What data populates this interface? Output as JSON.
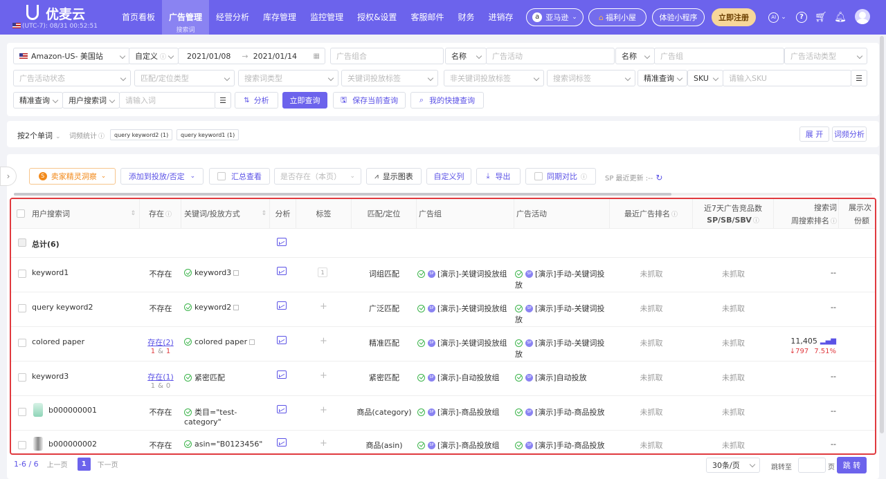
{
  "app": {
    "logo": "优麦云",
    "timezone": "(UTC-7): 08/31 00:52:51"
  },
  "nav": [
    {
      "label": "首页看板"
    },
    {
      "label": "广告管理",
      "sub": "搜索词",
      "active": true
    },
    {
      "label": "经营分析"
    },
    {
      "label": "库存管理"
    },
    {
      "label": "监控管理"
    },
    {
      "label": "授权&设置"
    },
    {
      "label": "客服邮件"
    },
    {
      "label": "财务"
    },
    {
      "label": "进销存"
    }
  ],
  "header": {
    "platform": "亚马逊",
    "welfare": "福利小屋",
    "miniapp": "体验小程序",
    "register": "立即注册",
    "ai": "AI"
  },
  "filters": {
    "store": "Amazon-US- 美国站",
    "date_mode": "自定义",
    "date_start": "2021/01/08",
    "date_end": "2021/01/14",
    "ad_group_ph": "广告组合",
    "name1": "名称",
    "campaign_ph": "广告活动",
    "name2": "名称",
    "adgroup_ph": "广告组",
    "campaign_type_ph": "广告活动类型",
    "campaign_status_ph": "广告活动状态",
    "match_type_ph": "匹配/定位类型",
    "search_type_ph": "搜索词类型",
    "kw_tag_ph": "关键词投放标签",
    "nonkw_tag_ph": "非关键词投放标签",
    "search_tag_ph": "搜索词标签",
    "exact1": "精准查询",
    "sku": "SKU",
    "sku_ph": "请输入SKU",
    "exact2": "精准查询",
    "user_search": "用户搜索词",
    "input_ph": "请输入词",
    "analyze": "分析",
    "query": "立即查询",
    "save": "保存当前查询",
    "quick": "我的快捷查询"
  },
  "words": {
    "split": "按2个单词",
    "freq": "词频统计",
    "tags": [
      "query keyword2 (1)",
      "query keyword1 (1)"
    ],
    "expand": "展 开",
    "freq_analysis": "词频分析"
  },
  "toolbar": {
    "insight": "卖家精灵洞察",
    "add": "添加到投放/否定",
    "summary": "汇总查看",
    "exists_ph": "是否存在（本页）",
    "show_chart": "显示图表",
    "custom_col": "自定义列",
    "export": "导出",
    "compare": "同期对比",
    "updated": "SP 最近更新 :--"
  },
  "table": {
    "headers": {
      "term": "用户搜索词",
      "exists": "存在",
      "keyword": "关键词/投放方式",
      "analysis": "分析",
      "tag": "标签",
      "match": "匹配/定位",
      "adgroup": "广告组",
      "campaign": "广告活动",
      "rank": "最近广告排名",
      "comp1": "近7天广告竞品数",
      "comp2": "SP/SB/SBV",
      "search1": "搜索词",
      "search2": "周搜索排名",
      "show1": "展示次",
      "show2": "份额"
    },
    "total": "总计(6)",
    "rows": [
      {
        "term": "keyword1",
        "exists": "不存在",
        "keyword": "keyword3",
        "tag": "1",
        "match": "词组匹配",
        "adgroup": "[演示]-关键词投放组",
        "campaign": "[演示]手动-关键词投",
        "campaign2": "放",
        "rank": "未抓取",
        "comp": "未抓取",
        "search": "--"
      },
      {
        "term": "query keyword2",
        "exists": "不存在",
        "keyword": "keyword2",
        "tag": "",
        "match": "广泛匹配",
        "adgroup": "[演示]-关键词投放组",
        "campaign": "[演示]手动-关键词投",
        "campaign2": "放",
        "rank": "未抓取",
        "comp": "未抓取",
        "search": "--"
      },
      {
        "term": "colored paper",
        "exists": "存在(2)",
        "exists_a": "1",
        "exists_sep": "&",
        "exists_b": "1",
        "keyword": "colored paper",
        "tag": "",
        "match": "精准匹配",
        "adgroup": "[演示]-关键词投放组",
        "campaign": "[演示]手动-关键词投",
        "campaign2": "放",
        "rank": "未抓取",
        "comp": "未抓取",
        "search": "11,405",
        "search_delta": "↓797",
        "search_pct": "7.51%"
      },
      {
        "term": "keyword3",
        "exists": "存在(1)",
        "exists_a": "1",
        "exists_sep": "&",
        "exists_b": "0",
        "keyword": "紧密匹配",
        "tag": "",
        "match": "紧密匹配",
        "adgroup": "[演示]-自动投放组",
        "campaign": "[演示]自动投放",
        "campaign2": "",
        "rank": "未抓取",
        "comp": "未抓取",
        "search": "--"
      },
      {
        "term": "b000000001",
        "exists": "不存在",
        "keyword": "类目=\"test-",
        "keyword2": "category\"",
        "tag": "",
        "match": "商品(category)",
        "adgroup": "[演示]-商品投放组",
        "campaign": "[演示]手动-商品投放",
        "campaign2": "",
        "rank": "未抓取",
        "comp": "未抓取",
        "search": "--"
      },
      {
        "term": "b000000002",
        "exists": "不存在",
        "keyword": "asin=\"B0123456\"",
        "tag": "",
        "match": "商品(asin)",
        "adgroup": "[演示]-商品投放组",
        "campaign": "[演示]手动-商品投放",
        "campaign2": "",
        "rank": "未抓取",
        "comp": "未抓取",
        "search": "--"
      }
    ]
  },
  "pager": {
    "range": "1-6 / 6",
    "prev": "上一页",
    "page": "1",
    "next": "下一页",
    "size": "30条/页",
    "goto": "跳转至",
    "unit": "页",
    "jump": "跳 转"
  },
  "colors": {
    "brand": "#6c63ec",
    "highlight_border": "#e0393e",
    "ok": "#3bb44a"
  }
}
